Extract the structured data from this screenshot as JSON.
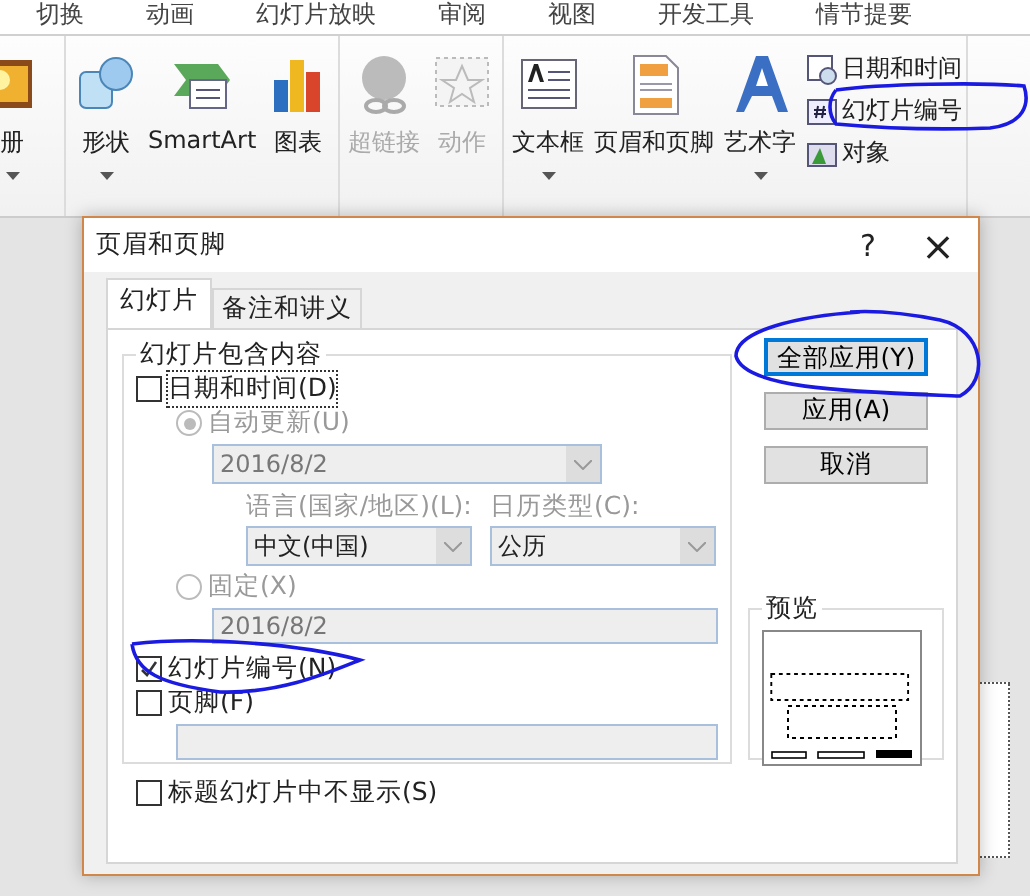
{
  "ribbon_tabs": [
    "切换",
    "动画",
    "幻灯片放映",
    "审阅",
    "视图",
    "开发工具",
    "情节提要"
  ],
  "ribbon_groups": [
    {
      "buttons": [
        {
          "kind": "album",
          "label": "册",
          "dropdown": true,
          "disabled": false
        }
      ]
    },
    {
      "buttons": [
        {
          "kind": "shapes",
          "label": "形状",
          "dropdown": true,
          "disabled": false
        },
        {
          "kind": "smartart",
          "label": "SmartArt",
          "dropdown": false,
          "disabled": false
        },
        {
          "kind": "chart",
          "label": "图表",
          "dropdown": false,
          "disabled": false
        }
      ]
    },
    {
      "buttons": [
        {
          "kind": "hyperlink",
          "label": "超链接",
          "dropdown": false,
          "disabled": true
        },
        {
          "kind": "action",
          "label": "动作",
          "dropdown": false,
          "disabled": true
        }
      ]
    },
    {
      "buttons": [
        {
          "kind": "textbox",
          "label": "文本框",
          "dropdown": true,
          "disabled": false
        },
        {
          "kind": "header-footer",
          "label": "页眉和页脚",
          "dropdown": false,
          "disabled": false
        },
        {
          "kind": "wordart",
          "label": "艺术字",
          "dropdown": true,
          "disabled": false
        }
      ],
      "small_buttons": [
        {
          "kind": "datetime",
          "label": "日期和时间"
        },
        {
          "kind": "slide-number",
          "label": "幻灯片编号"
        },
        {
          "kind": "object",
          "label": "对象"
        }
      ]
    }
  ],
  "dialog": {
    "title": "页眉和页脚",
    "help": "?",
    "close": "×",
    "tabs": [
      {
        "label": "幻灯片",
        "selected": true
      },
      {
        "label": "备注和讲义",
        "selected": false
      }
    ],
    "group_title": "幻灯片包含内容",
    "date_time": {
      "label": "日期和时间(D)",
      "checked": false
    },
    "auto_update": {
      "label": "自动更新(U)",
      "selected": true,
      "disabled": true
    },
    "auto_date": {
      "value": "2016/8/2",
      "disabled": true
    },
    "language": {
      "label": "语言(国家/地区)(L):",
      "value": "中文(中国)",
      "disabled": true
    },
    "calendar": {
      "label": "日历类型(C):",
      "value": "公历",
      "disabled": true
    },
    "fixed": {
      "label": "固定(X)",
      "selected": false,
      "disabled": true
    },
    "fixed_date": {
      "value": "2016/8/2",
      "disabled": true
    },
    "slide_number": {
      "label": "幻灯片编号(N)",
      "checked": true
    },
    "footer": {
      "label": "页脚(F)",
      "checked": false
    },
    "hide_on_title": {
      "label": "标题幻灯片中不显示(S)",
      "checked": false
    },
    "buttons": [
      {
        "label": "全部应用(Y)",
        "focused": true
      },
      {
        "label": "应用(A)",
        "focused": false
      },
      {
        "label": "取消",
        "focused": false
      }
    ],
    "preview_title": "预览"
  }
}
